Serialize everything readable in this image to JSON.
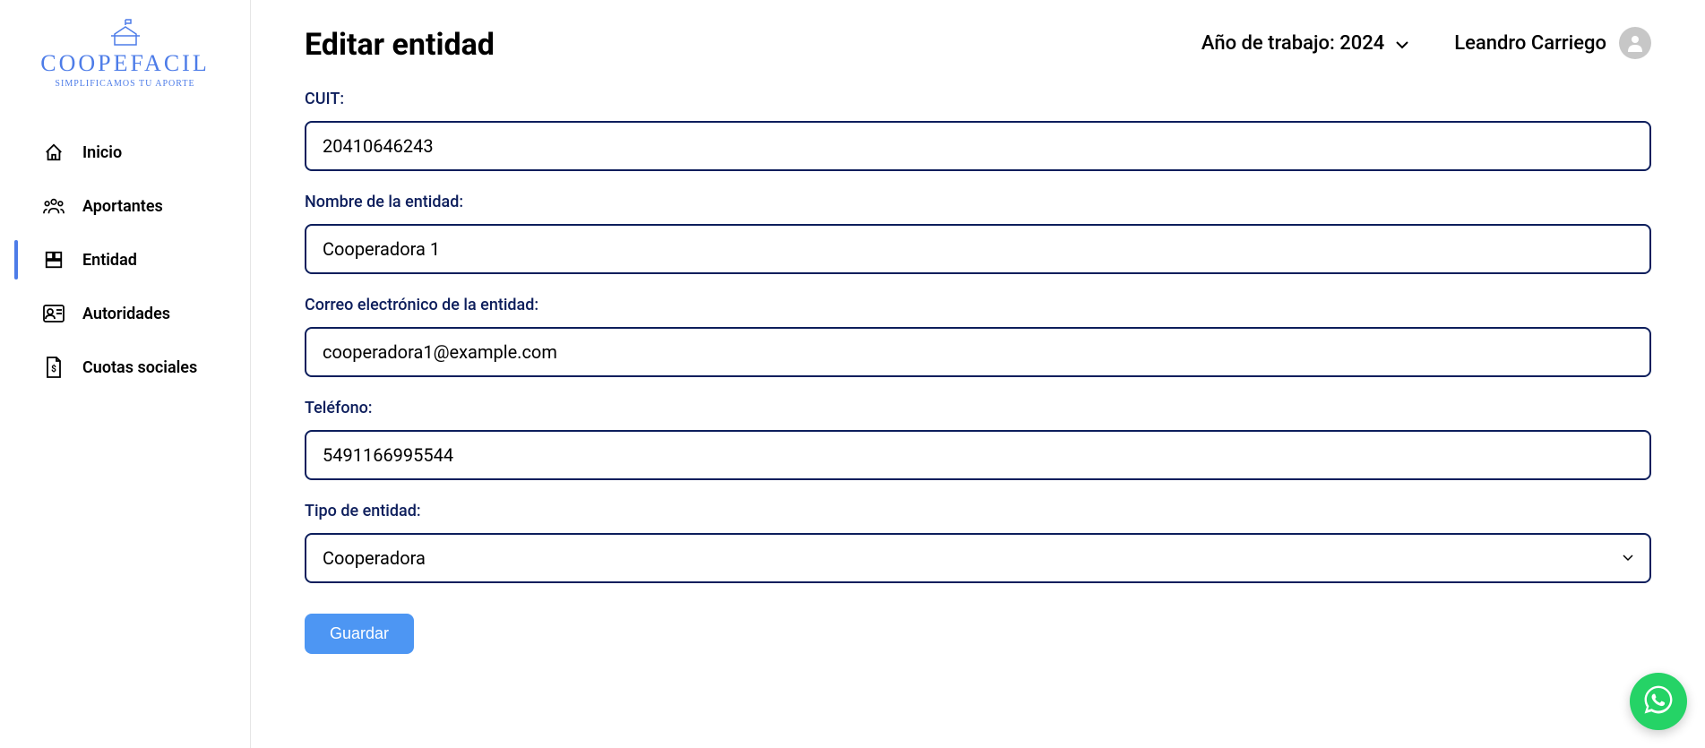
{
  "logo": {
    "main": "COOPEFACIL",
    "sub": "SIMPLIFICAMOS TU APORTE"
  },
  "sidebar": {
    "items": [
      {
        "label": "Inicio",
        "icon": "home-icon"
      },
      {
        "label": "Aportantes",
        "icon": "people-icon"
      },
      {
        "label": "Entidad",
        "icon": "building-icon",
        "active": true
      },
      {
        "label": "Autoridades",
        "icon": "id-card-icon"
      },
      {
        "label": "Cuotas sociales",
        "icon": "document-dollar-icon"
      }
    ]
  },
  "header": {
    "title": "Editar entidad",
    "year_label": "Año de trabajo: 2024",
    "user_name": "Leandro Carriego"
  },
  "form": {
    "cuit_label": "CUIT:",
    "cuit_value": "20410646243",
    "name_label": "Nombre de la entidad:",
    "name_value": "Cooperadora 1",
    "email_label": "Correo electrónico de la entidad:",
    "email_value": "cooperadora1@example.com",
    "phone_label": "Teléfono:",
    "phone_value": "5491166995544",
    "type_label": "Tipo de entidad:",
    "type_value": "Cooperadora",
    "save_button": "Guardar"
  }
}
